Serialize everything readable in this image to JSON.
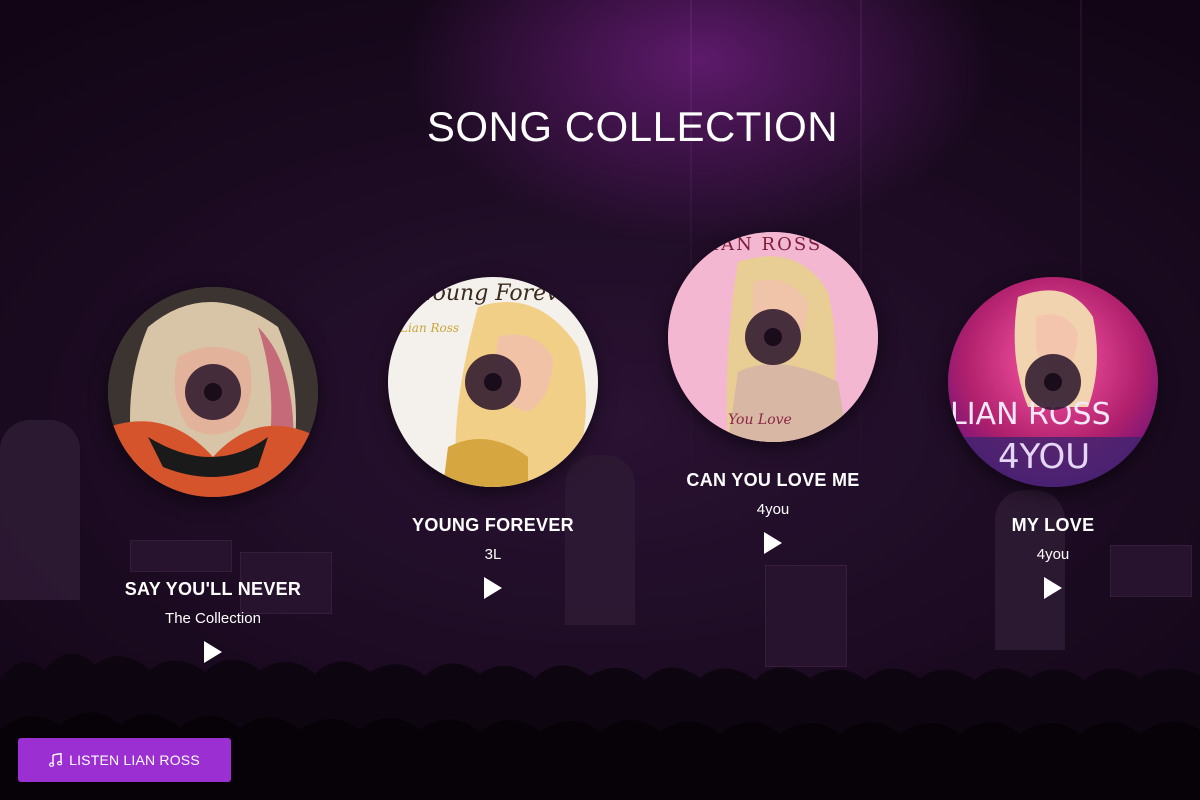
{
  "page": {
    "title": "SONG COLLECTION"
  },
  "songs": [
    {
      "title": "SAY YOU'LL NEVER",
      "album": "The Collection",
      "cover_icon": "album-cover-art",
      "cover_text": ""
    },
    {
      "title": "YOUNG FOREVER",
      "album": "3L",
      "cover_icon": "album-cover-art",
      "cover_text": "Young Forever",
      "cover_subtext": "Lian Ross"
    },
    {
      "title": "CAN YOU LOVE ME",
      "album": "4you",
      "cover_icon": "album-cover-art",
      "cover_text": "LIAN ROSS",
      "cover_subtext": "You Love"
    },
    {
      "title": "MY LOVE",
      "album": "4you",
      "cover_icon": "album-cover-art",
      "cover_text": "LIAN ROSS",
      "cover_subtext": "4YOU"
    }
  ],
  "footer": {
    "listen_label": "LISTEN LIAN ROSS",
    "listen_icon": "music-note-icon"
  },
  "colors": {
    "accent": "#9b2fd1",
    "background": "#1c0b22",
    "text": "#ffffff"
  }
}
